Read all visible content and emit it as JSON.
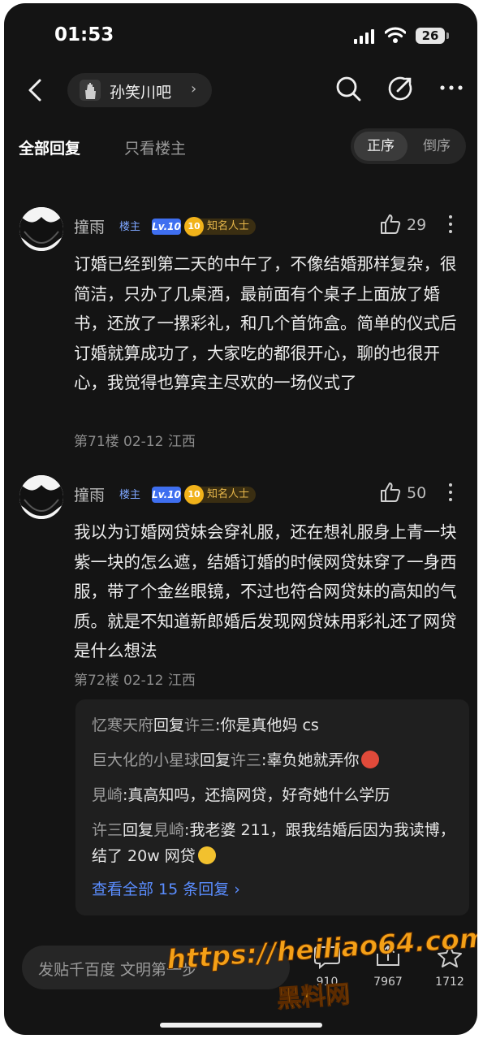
{
  "status_bar": {
    "time": "01:53",
    "battery": "26"
  },
  "nav": {
    "forum_name": "孙笑川吧"
  },
  "tabs": {
    "all": "全部回复",
    "op_only": "只看楼主"
  },
  "sort": {
    "asc": "正序",
    "desc": "倒序"
  },
  "posts": [
    {
      "username": "撞雨",
      "op_badge": "楼主",
      "level": "Lv.10",
      "star_level": "10",
      "title_badge": "知名人士",
      "likes": "29",
      "content": "订婚已经到第二天的中午了，不像结婚那样复杂，很简洁，只办了几桌酒，最前面有个桌子上面放了婚书，还放了一摞彩礼，和几个首饰盒。简单的仪式后订婚就算成功了，大家吃的都很开心，聊的也很开心，我觉得也算宾主尽欢的一场仪式了",
      "meta": "第71楼  02-12  江西"
    },
    {
      "username": "撞雨",
      "op_badge": "楼主",
      "level": "Lv.10",
      "star_level": "10",
      "title_badge": "知名人士",
      "likes": "50",
      "content": "我以为订婚网贷妹会穿礼服，还在想礼服身上青一块紫一块的怎么遮，结婚订婚的时候网贷妹穿了一身西服，带了个金丝眼镜，不过也符合网贷妹的高知的气质。就是不知道新郎婚后发现网贷妹用彩礼还了网贷是什么想法",
      "meta": "第72楼  02-12  江西"
    }
  ],
  "replies": {
    "items": [
      {
        "from": "忆寒天府",
        "action": "回复",
        "to": "许三",
        "text": ":你是真他妈 cs"
      },
      {
        "from": "巨大化的小星球",
        "action": "回复",
        "to": "许三",
        "text": ":辜负她就弄你"
      },
      {
        "from": "見崎",
        "action": "",
        "to": "",
        "text": ":真高知吗，还搞网贷，好奇她什么学历"
      },
      {
        "from": "许三",
        "action": "回复",
        "to": "見崎",
        "text": ":我老婆 211，跟我结婚后因为我读博，结了 20w 网贷"
      }
    ],
    "view_all": "查看全部 15 条回复 ›"
  },
  "bottom_bar": {
    "placeholder": "发贴千百度 文明第一步",
    "comments": "910",
    "shares": "7967",
    "favorites": "1712"
  },
  "watermark": {
    "line1": "https://heiliao64.com",
    "line2": "黑料网"
  }
}
